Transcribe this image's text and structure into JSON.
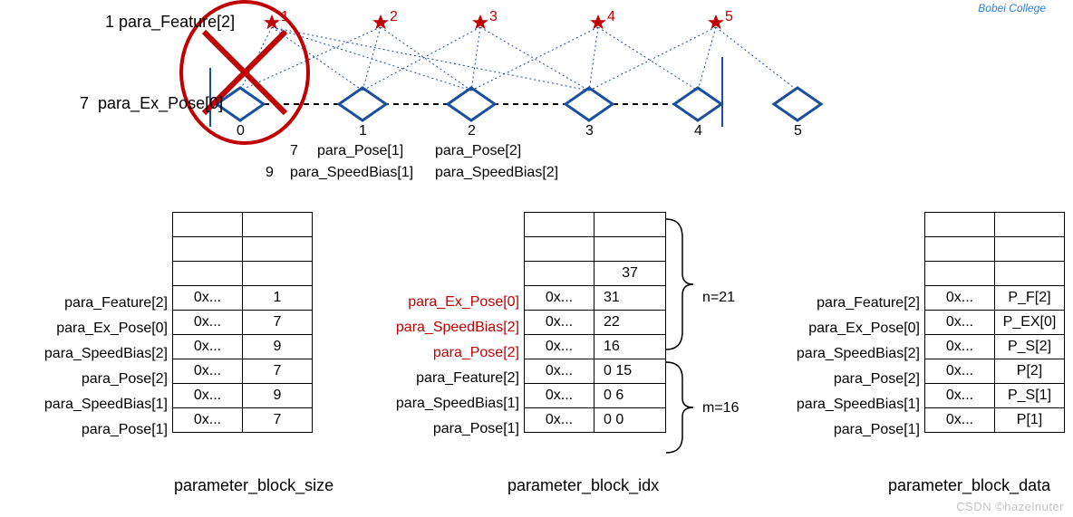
{
  "top_logo": "Bobei College",
  "feature_label": "para_Feature[2]",
  "feature_prefix": "1",
  "expose_label": "para_Ex_Pose[0]",
  "expose_prefix": "7",
  "stars": [
    "1",
    "2",
    "3",
    "4",
    "5"
  ],
  "frames": [
    "0",
    "1",
    "2",
    "3",
    "4",
    "5"
  ],
  "mid_labels": {
    "p7": "7",
    "p9": "9",
    "pose1": "para_Pose[1]",
    "pose2": "para_Pose[2]",
    "sb1": "para_SpeedBias[1]",
    "sb2": "para_SpeedBias[2]"
  },
  "n_label": "n=21",
  "m_label": "m=16",
  "table_size": {
    "title": "parameter_block_size",
    "rows": [
      {
        "label": "para_Feature[2]",
        "addr": "0x...",
        "val": "1"
      },
      {
        "label": "para_Ex_Pose[0]",
        "addr": "0x...",
        "val": "7"
      },
      {
        "label": "para_SpeedBias[2]",
        "addr": "0x...",
        "val": "9"
      },
      {
        "label": "para_Pose[2]",
        "addr": "0x...",
        "val": "7"
      },
      {
        "label": "para_SpeedBias[1]",
        "addr": "0x...",
        "val": "9"
      },
      {
        "label": "para_Pose[1]",
        "addr": "0x...",
        "val": "7"
      }
    ]
  },
  "table_idx": {
    "title": "parameter_block_idx",
    "pre_rows": 3,
    "top37": "37",
    "rows": [
      {
        "label": "para_Ex_Pose[0]",
        "addr": "0x...",
        "val": "31",
        "red": true
      },
      {
        "label": "para_SpeedBias[2]",
        "addr": "0x...",
        "val": "22",
        "red": true
      },
      {
        "label": "para_Pose[2]",
        "addr": "0x...",
        "val": "16",
        "red": true
      },
      {
        "label": "para_Feature[2]",
        "addr": "0x...",
        "val": "0  15",
        "red": false
      },
      {
        "label": "para_SpeedBias[1]",
        "addr": "0x...",
        "val": "0  6",
        "red": false
      },
      {
        "label": "para_Pose[1]",
        "addr": "0x...",
        "val": "0  0",
        "red": false
      }
    ]
  },
  "table_data": {
    "title": "parameter_block_data",
    "rows": [
      {
        "label": "para_Feature[2]",
        "addr": "0x...",
        "val": "P_F[2]"
      },
      {
        "label": "para_Ex_Pose[0]",
        "addr": "0x...",
        "val": "P_EX[0]"
      },
      {
        "label": "para_SpeedBias[2]",
        "addr": "0x...",
        "val": "P_S[2]"
      },
      {
        "label": "para_Pose[2]",
        "addr": "0x...",
        "val": "P[2]"
      },
      {
        "label": "para_SpeedBias[1]",
        "addr": "0x...",
        "val": "P_S[1]"
      },
      {
        "label": "para_Pose[1]",
        "addr": "0x...",
        "val": "P[1]"
      }
    ]
  },
  "watermark": "CSDN ©hazelnuter"
}
